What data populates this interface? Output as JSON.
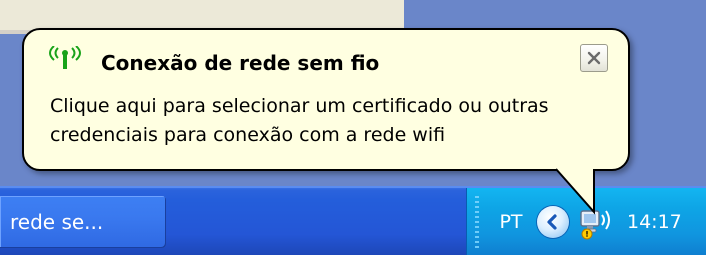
{
  "taskbar": {
    "task_button_label": "rede se..."
  },
  "tray": {
    "language": "PT",
    "clock": "14:17",
    "expand_icon": "chevron-left-icon",
    "network_icon": "wireless-network-icon"
  },
  "balloon": {
    "title_icon": "wireless-signal-icon",
    "title": "Conexão de rede sem fio",
    "message_lines": [
      "Clique aqui para selecionar um certificado ou outras",
      "credenciais para conexão com a rede wifi"
    ],
    "close_icon": "close-icon"
  },
  "colors": {
    "balloon_background": "#ffffe1",
    "taskbar_blue": "#245edb",
    "tray_blue": "#0ea5e6",
    "signal_green": "#19a319"
  }
}
